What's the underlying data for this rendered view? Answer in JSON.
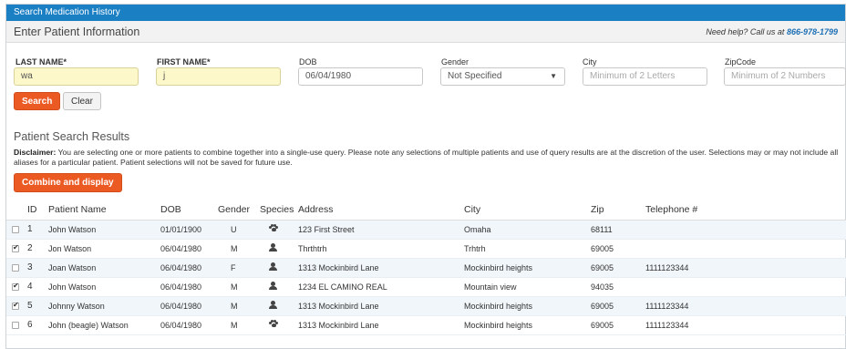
{
  "topbar": {
    "title": "Search Medication History"
  },
  "patient_info": {
    "title": "Enter Patient Information",
    "help_text": "Need help? Call us at",
    "help_phone": "866-978-1799"
  },
  "form": {
    "last_name": {
      "label": "LAST NAME*",
      "value": "wa"
    },
    "first_name": {
      "label": "FIRST NAME*",
      "value": "j"
    },
    "dob": {
      "label": "DOB",
      "value": "06/04/1980"
    },
    "gender": {
      "label": "Gender",
      "value": "Not Specified"
    },
    "city": {
      "label": "City",
      "placeholder": "Minimum of 2 Letters"
    },
    "zip": {
      "label": "ZipCode",
      "placeholder": "Minimum of 2 Numbers"
    },
    "search_label": "Search",
    "clear_label": "Clear"
  },
  "results": {
    "title": "Patient Search Results",
    "disclaimer_label": "Disclaimer:",
    "disclaimer_text": " You are selecting one or more patients to combine together into a single-use query. Please note any selections of multiple patients and use of query results are at the discretion of the user. Selections may or may not include all aliases for a particular patient. Patient selections will not be saved for future use.",
    "combine_label": "Combine and display",
    "columns": [
      "ID",
      "Patient Name",
      "DOB",
      "Gender",
      "Species",
      "Address",
      "City",
      "Zip",
      "Telephone #"
    ],
    "rows": [
      {
        "checked": false,
        "id": "1",
        "name": "John Watson",
        "dob": "01/01/1900",
        "gender": "U",
        "species": "paw-icon",
        "address": "123 First Street",
        "city": "Omaha",
        "zip": "68111",
        "phone": ""
      },
      {
        "checked": true,
        "id": "2",
        "name": "Jon Watson",
        "dob": "06/04/1980",
        "gender": "M",
        "species": "person-icon",
        "address": "Thrthtrh",
        "city": "Trhtrh",
        "zip": "69005",
        "phone": ""
      },
      {
        "checked": false,
        "id": "3",
        "name": "Joan Watson",
        "dob": "06/04/1980",
        "gender": "F",
        "species": "person-icon",
        "address": "1313 Mockinbird Lane",
        "city": "Mockinbird heights",
        "zip": "69005",
        "phone": "1111123344"
      },
      {
        "checked": true,
        "id": "4",
        "name": "John Watson",
        "dob": "06/04/1980",
        "gender": "M",
        "species": "person-icon",
        "address": "1234 EL CAMINO REAL",
        "city": "Mountain view",
        "zip": "94035",
        "phone": ""
      },
      {
        "checked": true,
        "id": "5",
        "name": "Johnny Watson",
        "dob": "06/04/1980",
        "gender": "M",
        "species": "person-icon",
        "address": "1313 Mockinbird Lane",
        "city": "Mockinbird heights",
        "zip": "69005",
        "phone": "1111123344"
      },
      {
        "checked": false,
        "id": "6",
        "name": "John (beagle) Watson",
        "dob": "06/04/1980",
        "gender": "M",
        "species": "paw-icon",
        "address": "1313 Mockinbird Lane",
        "city": "Mockinbird heights",
        "zip": "69005",
        "phone": "1111123344"
      }
    ]
  },
  "colors": {
    "header_blue": "#1b7fc4",
    "accent_orange": "#ec5a24",
    "required_yellow": "#fcf8c9"
  }
}
